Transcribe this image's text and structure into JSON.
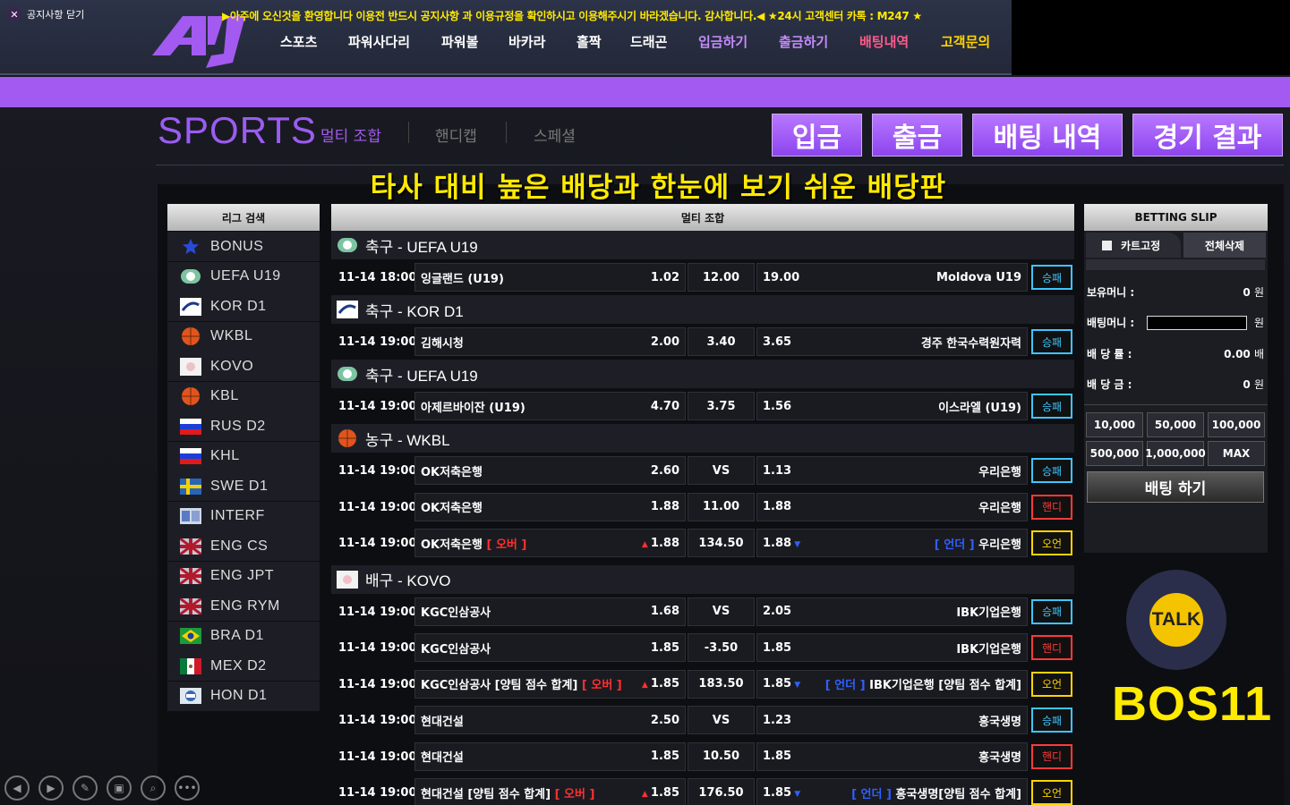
{
  "nav": {
    "items": [
      {
        "label": "스포츠",
        "color": "#ffffff"
      },
      {
        "label": "파워사다리",
        "color": "#ffffff"
      },
      {
        "label": "파워볼",
        "color": "#ffffff"
      },
      {
        "label": "바카라",
        "color": "#ffffff"
      },
      {
        "label": "홀짝",
        "color": "#ffffff"
      },
      {
        "label": "드래곤",
        "color": "#ffffff"
      },
      {
        "label": "입금하기",
        "color": "#c58bff"
      },
      {
        "label": "출금하기",
        "color": "#c58bff"
      },
      {
        "label": "배팅내역",
        "color": "#ff5a8a"
      },
      {
        "label": "고객문의",
        "color": "#ffd400"
      }
    ]
  },
  "notice": {
    "close_label": "공지사항 닫기",
    "text": "▶아주에 오신것을 환영합니다 이용전 반드시 공지사항 과 이용규정을 확인하시고 이용해주시기 바라겠습니다. 감사합니다.◀ ★24시 고객센터 카톡 : M247 ★"
  },
  "sports": {
    "title": "SPORTS",
    "tabs": [
      "멀티 조합",
      "핸디캡",
      "스페셜"
    ],
    "buttons": [
      "입금",
      "출금",
      "배팅 내역",
      "경기 결과"
    ]
  },
  "promo": "타사 대비 높은 배당과 한눈에 보기 쉬운 배당판",
  "league_panel": {
    "title": "리그 검색",
    "leagues": [
      {
        "name": "BONUS",
        "icon": "star-icon"
      },
      {
        "name": "UEFA U19",
        "icon": "soccer-icon"
      },
      {
        "name": "KOR D1",
        "icon": "kleague-icon"
      },
      {
        "name": "WKBL",
        "icon": "basketball-icon"
      },
      {
        "name": "KOVO",
        "icon": "volleyball-icon"
      },
      {
        "name": "KBL",
        "icon": "basketball-icon"
      },
      {
        "name": "RUS D2",
        "icon": "russia-flag-icon"
      },
      {
        "name": "KHL",
        "icon": "russia-flag-icon"
      },
      {
        "name": "SWE D1",
        "icon": "sweden-flag-icon"
      },
      {
        "name": "INTERF",
        "icon": "interf-icon"
      },
      {
        "name": "ENG CS",
        "icon": "uk-flag-icon"
      },
      {
        "name": "ENG JPT",
        "icon": "uk-flag-icon"
      },
      {
        "name": "ENG RYM",
        "icon": "uk-flag-icon"
      },
      {
        "name": "BRA D1",
        "icon": "brazil-flag-icon"
      },
      {
        "name": "MEX D2",
        "icon": "mexico-flag-icon"
      },
      {
        "name": "HON D1",
        "icon": "honduras-flag-icon"
      }
    ]
  },
  "games": {
    "title": "멀티 조합",
    "sections": [
      {
        "header": "축구 - UEFA U19",
        "icon": "soccer-icon",
        "rows": [
          {
            "time": "11-14 18:00",
            "home": "잉글랜드 (U19)",
            "home_odds": "1.02",
            "draw": "12.00",
            "away_odds": "19.00",
            "away": "Moldova U19",
            "type": "승패"
          }
        ]
      },
      {
        "header": "축구 - KOR D1",
        "icon": "kleague-icon",
        "rows": [
          {
            "time": "11-14 19:00",
            "home": "김해시청",
            "home_odds": "2.00",
            "draw": "3.40",
            "away_odds": "3.65",
            "away": "경주 한국수력원자력",
            "type": "승패"
          }
        ]
      },
      {
        "header": "축구 - UEFA U19",
        "icon": "soccer-icon",
        "rows": [
          {
            "time": "11-14 19:00",
            "home": "아제르바이잔 (U19)",
            "home_odds": "4.70",
            "draw": "3.75",
            "away_odds": "1.56",
            "away": "이스라엘 (U19)",
            "type": "승패"
          }
        ]
      },
      {
        "header": "농구 - WKBL",
        "icon": "basketball-icon",
        "rows": [
          {
            "time": "11-14 19:00",
            "home": "OK저축은행",
            "home_odds": "2.60",
            "draw": "VS",
            "away_odds": "1.13",
            "away": "우리은행",
            "type": "승패"
          },
          {
            "time": "11-14 19:00",
            "home": "OK저축은행",
            "home_odds": "1.88",
            "draw": "11.00",
            "away_odds": "1.88",
            "away": "우리은행",
            "type": "핸디"
          },
          {
            "time": "11-14 19:00",
            "home": "OK저축은행",
            "home_tag": "[ 오버 ]",
            "home_odds": "1.88",
            "draw": "134.50",
            "away_odds": "1.88",
            "away_tag": "[ 언더 ]",
            "away": "우리은행",
            "type": "오언"
          }
        ]
      },
      {
        "header": "배구 - KOVO",
        "icon": "volleyball-icon",
        "rows": [
          {
            "time": "11-14 19:00",
            "home": "KGC인삼공사",
            "home_odds": "1.68",
            "draw": "VS",
            "away_odds": "2.05",
            "away": "IBK기업은행",
            "type": "승패"
          },
          {
            "time": "11-14 19:00",
            "home": "KGC인삼공사",
            "home_odds": "1.85",
            "draw": "-3.50",
            "away_odds": "1.85",
            "away": "IBK기업은행",
            "type": "핸디"
          },
          {
            "time": "11-14 19:00",
            "home": "KGC인삼공사 [양팀 점수 합계]",
            "home_tag": "[ 오버 ]",
            "home_odds": "1.85",
            "draw": "183.50",
            "away_odds": "1.85",
            "away_tag": "[ 언더 ]",
            "away": "IBK기업은행 [양팀 점수 합계]",
            "type": "오언"
          },
          {
            "time": "11-14 19:00",
            "home": "현대건설",
            "home_odds": "2.50",
            "draw": "VS",
            "away_odds": "1.23",
            "away": "흥국생명",
            "type": "승패"
          },
          {
            "time": "11-14 19:00",
            "home": "현대건설",
            "home_odds": "1.85",
            "draw": "10.50",
            "away_odds": "1.85",
            "away": "흥국생명",
            "type": "핸디"
          },
          {
            "time": "11-14 19:00",
            "home": "현대건설 [양팀 점수 합계]",
            "home_tag": "[ 오버 ]",
            "home_odds": "1.85",
            "draw": "176.50",
            "away_odds": "1.85",
            "away_tag": "[ 언더 ]",
            "away": "흥국생명[양팀 점수 합계]",
            "type": "오언"
          }
        ]
      }
    ]
  },
  "slip": {
    "title": "BETTING SLIP",
    "cart_fix": "카트고정",
    "delete_all": "전체삭제",
    "balance_label": "보유머니 :",
    "balance_value": "0",
    "balance_unit": "원",
    "bet_label": "배팅머니 :",
    "bet_unit": "원",
    "rate_label": "배 당 률 :",
    "rate_value": "0.00",
    "rate_unit": "배",
    "payout_label": "배 당 금 :",
    "payout_value": "0",
    "payout_unit": "원",
    "amounts": [
      "10,000",
      "50,000",
      "100,000",
      "500,000",
      "1,000,000",
      "MAX"
    ],
    "bet_button": "배팅 하기"
  },
  "talk_label": "TALK",
  "brand": "BOS11"
}
